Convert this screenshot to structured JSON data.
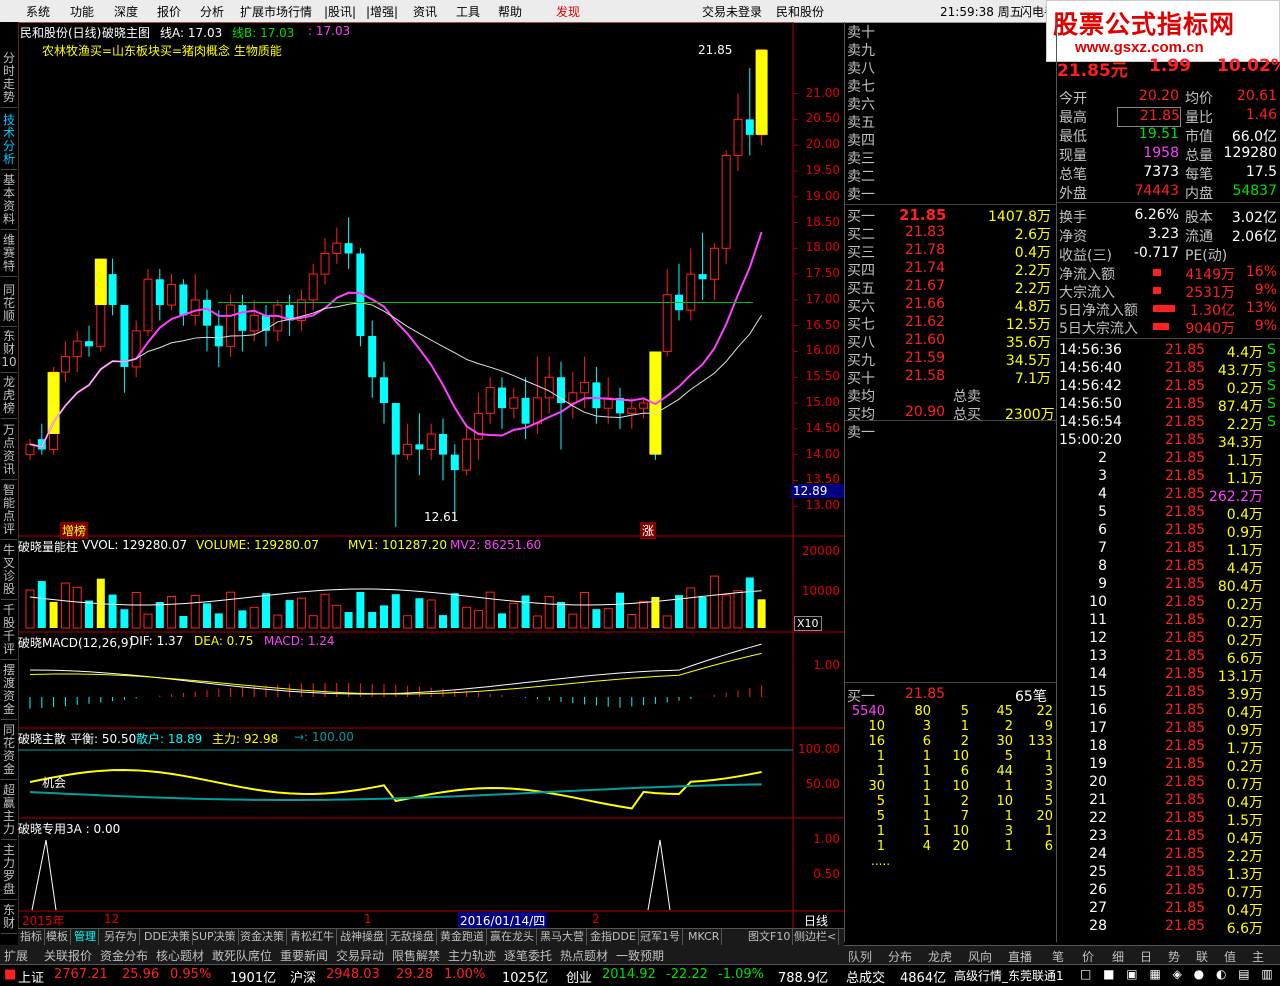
{
  "menu": [
    "系统",
    "功能",
    "深度",
    "报价",
    "分析",
    "扩展市场行情",
    "|股讯|",
    "|增强|",
    "资讯",
    "工具",
    "帮助",
    "发现"
  ],
  "menu_right": {
    "login": "交易未登录",
    "broker": "民和股份",
    "time": "21:59:38 周五",
    "flash": "闪电手"
  },
  "brand": {
    "title": "股票公式指标网",
    "url": "www.gsxz.com.cn"
  },
  "left_nav": [
    "分时走势",
    "技术分析",
    "基本资料",
    "维赛特",
    "同花顺",
    "东财10",
    "龙虎榜",
    "万点资讯",
    "智能点评",
    "牛叉诊股",
    "千股千评",
    "摆渡资金",
    "同花资金",
    "超赢主力",
    "主力罗盘",
    "东财"
  ],
  "main_title": {
    "stock": "民和股份(日线)",
    "indicator": "破晓主图",
    "lineA": "线A: 17.03",
    "lineB": "线B: 17.03",
    "extra": ": 17.03"
  },
  "annotation_text": {
    "pre": "农林牧渔买=",
    "board": "山东板块买=",
    "concept": "猪肉概念 生物质能"
  },
  "price_axis": [
    "21.00",
    "20.50",
    "20.00",
    "19.50",
    "19.00",
    "18.50",
    "18.00",
    "17.50",
    "17.00",
    "16.50",
    "16.00",
    "15.50",
    "15.00",
    "14.50",
    "14.00",
    "13.50",
    "13.00"
  ],
  "last_price_tag": "12.89",
  "high_label": "21.85",
  "low_label": "12.61",
  "main_markers": {
    "left": "增榜",
    "right": "涨"
  },
  "volume_panel": {
    "title": "破晓量能柱",
    "vvol": "VVOL: 129280.07",
    "volume": "VOLUME: 129280.07",
    "mv1": "MV1: 101287.20",
    "mv2": "MV2: 86251.60",
    "ticks": [
      "20000",
      "10000"
    ],
    "unit": "X10"
  },
  "macd_panel": {
    "title": "破晓MACD(12,26,9)",
    "dif": "DIF: 1.37",
    "dea": "DEA: 0.75",
    "macd": "MACD: 1.24",
    "ticks": [
      "1.00"
    ]
  },
  "flow_panel": {
    "title": "破晓主散",
    "balance": "平衡: 50.50",
    "retail": "散户: 18.89",
    "main": "主力: 92.98",
    "arrow": "→: 100.00",
    "ticks": [
      "100.00",
      "50.00"
    ],
    "label": "机会"
  },
  "special_panel": {
    "title": "破晓专用3A : 0.00",
    "ticks": [
      "1.00",
      "0.50"
    ]
  },
  "date_axis": {
    "year": "2015年",
    "m12": "12",
    "m1": "1",
    "date": "2016/01/14/四",
    "m2": "2",
    "period": "日线"
  },
  "chart_data": [
    {
      "type": "candlestick",
      "title": "民和股份(日线)",
      "ylim": [
        12.5,
        22.0
      ],
      "candles": [
        [
          14.0,
          14.2,
          13.9,
          14.3
        ],
        [
          14.3,
          14.1,
          14.0,
          14.6
        ],
        [
          14.1,
          15.6,
          14.0,
          15.7
        ],
        [
          15.6,
          15.9,
          15.4,
          16.2
        ],
        [
          15.9,
          16.2,
          15.6,
          16.4
        ],
        [
          16.2,
          16.1,
          15.9,
          16.5
        ],
        [
          16.1,
          17.5,
          16.0,
          17.8
        ],
        [
          17.5,
          16.9,
          16.7,
          17.8
        ],
        [
          16.9,
          15.7,
          15.2,
          16.9
        ],
        [
          15.7,
          16.4,
          15.5,
          16.6
        ],
        [
          16.4,
          17.4,
          16.3,
          17.6
        ],
        [
          17.4,
          16.9,
          16.6,
          17.6
        ],
        [
          16.9,
          17.3,
          16.8,
          17.5
        ],
        [
          17.3,
          16.7,
          16.5,
          17.4
        ],
        [
          16.7,
          17.0,
          16.5,
          17.5
        ],
        [
          17.0,
          16.5,
          16.0,
          17.2
        ],
        [
          16.5,
          16.1,
          15.7,
          16.8
        ],
        [
          16.1,
          16.9,
          15.9,
          17.1
        ],
        [
          16.9,
          16.4,
          16.0,
          17.1
        ],
        [
          16.4,
          16.7,
          16.2,
          17.0
        ],
        [
          16.7,
          16.4,
          16.1,
          16.9
        ],
        [
          16.4,
          16.9,
          16.2,
          17.0
        ],
        [
          16.9,
          16.6,
          16.3,
          17.1
        ],
        [
          16.6,
          17.0,
          16.4,
          17.2
        ],
        [
          17.0,
          17.5,
          16.8,
          17.7
        ],
        [
          17.5,
          17.9,
          17.3,
          18.2
        ],
        [
          17.9,
          18.1,
          17.7,
          18.4
        ],
        [
          18.1,
          17.9,
          17.6,
          18.6
        ],
        [
          17.9,
          16.3,
          16.1,
          18.0
        ],
        [
          16.3,
          15.5,
          15.1,
          16.6
        ],
        [
          15.5,
          15.0,
          14.6,
          15.8
        ],
        [
          15.0,
          14.0,
          12.6,
          15.0
        ],
        [
          14.0,
          14.2,
          13.9,
          14.6
        ],
        [
          14.2,
          14.1,
          13.6,
          14.8
        ],
        [
          14.1,
          14.4,
          13.9,
          14.6
        ],
        [
          14.4,
          14.0,
          13.5,
          14.7
        ],
        [
          14.0,
          13.7,
          12.7,
          14.2
        ],
        [
          13.7,
          14.3,
          13.6,
          14.6
        ],
        [
          14.3,
          14.8,
          13.9,
          15.2
        ],
        [
          14.8,
          15.3,
          14.6,
          15.5
        ],
        [
          15.3,
          14.9,
          14.5,
          15.5
        ],
        [
          14.9,
          15.1,
          14.7,
          15.3
        ],
        [
          15.1,
          14.6,
          14.3,
          15.5
        ],
        [
          14.6,
          15.1,
          14.4,
          15.9
        ],
        [
          15.1,
          15.5,
          14.8,
          15.9
        ],
        [
          15.5,
          15.0,
          14.1,
          15.8
        ],
        [
          15.0,
          15.2,
          14.7,
          15.6
        ],
        [
          15.2,
          15.4,
          14.9,
          15.9
        ],
        [
          15.4,
          14.9,
          14.6,
          15.7
        ],
        [
          14.9,
          15.1,
          14.6,
          15.5
        ],
        [
          15.1,
          14.8,
          14.5,
          15.3
        ],
        [
          14.8,
          14.9,
          14.5,
          15.1
        ],
        [
          14.9,
          15.0,
          14.7,
          15.1
        ],
        [
          15.0,
          14.0,
          13.9,
          16.0
        ],
        [
          16.0,
          17.1,
          15.9,
          17.6
        ],
        [
          17.1,
          16.8,
          16.6,
          17.7
        ],
        [
          16.8,
          17.5,
          16.6,
          18.0
        ],
        [
          17.5,
          17.4,
          17.0,
          18.3
        ],
        [
          17.4,
          18.0,
          17.0,
          18.1
        ],
        [
          18.0,
          19.8,
          17.7,
          19.9
        ],
        [
          19.8,
          20.5,
          19.5,
          21.0
        ],
        [
          20.5,
          20.2,
          19.8,
          21.5
        ],
        [
          20.2,
          21.85,
          20.0,
          21.85
        ]
      ]
    }
  ],
  "orderbook": {
    "sell_labels": [
      "卖十",
      "卖九",
      "卖八",
      "卖七",
      "卖六",
      "卖五",
      "卖四",
      "卖三",
      "卖二",
      "卖一"
    ],
    "buy": [
      {
        "label": "买一",
        "price": "21.85",
        "vol": "1407.8万"
      },
      {
        "label": "买二",
        "price": "21.83",
        "vol": "2.6万"
      },
      {
        "label": "买三",
        "price": "21.78",
        "vol": "0.4万"
      },
      {
        "label": "买四",
        "price": "21.74",
        "vol": "2.2万"
      },
      {
        "label": "买五",
        "price": "21.67",
        "vol": "2.2万"
      },
      {
        "label": "买六",
        "price": "21.66",
        "vol": "4.8万"
      },
      {
        "label": "买七",
        "price": "21.62",
        "vol": "12.5万"
      },
      {
        "label": "买八",
        "price": "21.60",
        "vol": "35.6万"
      },
      {
        "label": "买九",
        "price": "21.59",
        "vol": "34.5万"
      },
      {
        "label": "买十",
        "price": "21.58",
        "vol": "7.1万"
      }
    ],
    "sell_avg": "卖均",
    "total_sell": "总卖",
    "buy_avg": "买均",
    "buy_avg_val": "20.90",
    "total_buy": "总买",
    "total_buy_val": "2300万",
    "sell_one": "卖一",
    "queue_header": {
      "label": "买一",
      "price": "21.85",
      "count": "65笔"
    },
    "queue": [
      [
        "5540",
        "80",
        "5",
        "45",
        "22"
      ],
      [
        "10",
        "3",
        "1",
        "2",
        "9"
      ],
      [
        "16",
        "6",
        "2",
        "30",
        "133"
      ],
      [
        "1",
        "1",
        "10",
        "5",
        "1"
      ],
      [
        "1",
        "1",
        "6",
        "44",
        "3"
      ],
      [
        "30",
        "1",
        "10",
        "1",
        "3"
      ],
      [
        "5",
        "1",
        "2",
        "10",
        "5"
      ],
      [
        "5",
        "1",
        "7",
        "1",
        "20"
      ],
      [
        "1",
        "1",
        "10",
        "3",
        "1"
      ],
      [
        "1",
        "4",
        "20",
        "1",
        "6"
      ]
    ],
    "more": "....."
  },
  "quote": {
    "price": "21.85元",
    "change": "1.99",
    "pct": "10.02%",
    "rows": [
      [
        "今开",
        "20.20",
        "均价",
        "20.61"
      ],
      [
        "最高",
        "21.85",
        "量比",
        "1.46"
      ],
      [
        "最低",
        "19.51",
        "市值",
        "66.0亿"
      ],
      [
        "现量",
        "1958",
        "总量",
        "129280"
      ],
      [
        "总笔",
        "7373",
        "每笔",
        "17.5"
      ],
      [
        "外盘",
        "74443",
        "内盘",
        "54837"
      ],
      [
        "换手",
        "6.26%",
        "股本",
        "3.02亿"
      ],
      [
        "净资",
        "3.23",
        "流通",
        "2.06亿"
      ],
      [
        "收益(三)",
        "-0.717",
        "PE(动)",
        ""
      ]
    ],
    "flows": [
      [
        "净流入额",
        "4149万",
        "16%"
      ],
      [
        "大宗流入",
        "2531万",
        "9%"
      ],
      [
        "5日净流入额",
        "1.30亿",
        "13%"
      ],
      [
        "5日大宗流入",
        "9040万",
        "9%"
      ]
    ],
    "ticks": [
      [
        "14:56:36",
        "21.85",
        "4.4万",
        "S"
      ],
      [
        "14:56:40",
        "21.85",
        "43.7万",
        "S"
      ],
      [
        "14:56:42",
        "21.85",
        "0.2万",
        "S"
      ],
      [
        "14:56:50",
        "21.85",
        "87.4万",
        "S"
      ],
      [
        "14:56:54",
        "21.85",
        "2.2万",
        "S"
      ],
      [
        "15:00:20",
        "21.85",
        "34.3万",
        ""
      ],
      [
        "2",
        "21.85",
        "1.1万",
        ""
      ],
      [
        "3",
        "21.85",
        "1.1万",
        ""
      ],
      [
        "4",
        "21.85",
        "262.2万",
        ""
      ],
      [
        "5",
        "21.85",
        "0.4万",
        ""
      ],
      [
        "6",
        "21.85",
        "0.9万",
        ""
      ],
      [
        "7",
        "21.85",
        "1.1万",
        ""
      ],
      [
        "8",
        "21.85",
        "4.4万",
        ""
      ],
      [
        "9",
        "21.85",
        "80.4万",
        ""
      ],
      [
        "10",
        "21.85",
        "0.2万",
        ""
      ],
      [
        "11",
        "21.85",
        "0.2万",
        ""
      ],
      [
        "12",
        "21.85",
        "0.2万",
        ""
      ],
      [
        "13",
        "21.85",
        "6.6万",
        ""
      ],
      [
        "14",
        "21.85",
        "13.1万",
        ""
      ],
      [
        "15",
        "21.85",
        "3.9万",
        ""
      ],
      [
        "16",
        "21.85",
        "0.4万",
        ""
      ],
      [
        "17",
        "21.85",
        "0.9万",
        ""
      ],
      [
        "18",
        "21.85",
        "1.7万",
        ""
      ],
      [
        "19",
        "21.85",
        "0.2万",
        ""
      ],
      [
        "20",
        "21.85",
        "0.7万",
        ""
      ],
      [
        "21",
        "21.85",
        "0.4万",
        ""
      ],
      [
        "22",
        "21.85",
        "1.5万",
        ""
      ],
      [
        "23",
        "21.85",
        "0.4万",
        ""
      ],
      [
        "24",
        "21.85",
        "2.2万",
        ""
      ],
      [
        "25",
        "21.85",
        "1.3万",
        ""
      ],
      [
        "26",
        "21.85",
        "0.7万",
        ""
      ],
      [
        "27",
        "21.85",
        "0.4万",
        ""
      ],
      [
        "28",
        "21.85",
        "6.6万",
        ""
      ]
    ]
  },
  "bottom_tabs": [
    "指标",
    "模板",
    "管理",
    "另存为",
    "DDE决策",
    "SUP决策",
    "资金决策",
    "青松红牛",
    "战神操盘",
    "无敌操盘",
    "黄金跑道",
    "赢在龙头",
    "黑马大营",
    "金指DDE",
    "冠军1号",
    "MKCR"
  ],
  "bottom_tabs_right": [
    "图文F10",
    "侧边栏<"
  ],
  "link_bar": [
    "扩展",
    "关联报价",
    "资金分布",
    "核心题材",
    "敢死队席位",
    "重要新闻",
    "交易异动",
    "限售解禁",
    "主力轨迹",
    "逐笔委托",
    "热点题材",
    "一致预期"
  ],
  "right_tabs": [
    "队列",
    "分布",
    "龙虎",
    "风向",
    "直播",
    "笔",
    "价",
    "细",
    "日",
    "势",
    "联",
    "值",
    "主"
  ],
  "status": {
    "sh_name": "上证",
    "sh_val": "2767.21",
    "sh_chg": "25.96",
    "sh_pct": "0.95%",
    "sh_amt": "1901亿",
    "hs_name": "沪深",
    "hs_val": "2948.03",
    "hs_chg": "29.28",
    "hs_pct": "1.00%",
    "hs_amt": "1025亿",
    "cy_name": "创业",
    "cy_val": "2014.92",
    "cy_chg": "-22.22",
    "cy_pct": "-1.09%",
    "cy_amt": "788.9亿",
    "total_label": "总成交",
    "total_val": "4864亿",
    "feed": "高级行情_东莞联通1"
  },
  "colors": {
    "up": "#ff2020",
    "down": "#00ffff",
    "yellow": "#ffff00",
    "magenta": "#ff40ff",
    "panel_border": "#b00000"
  }
}
